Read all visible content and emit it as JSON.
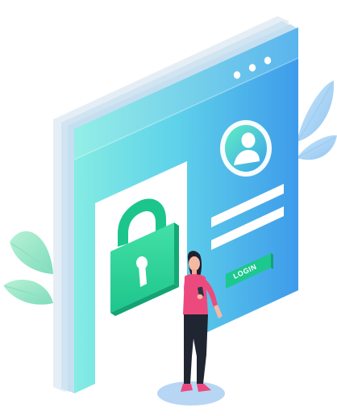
{
  "illustration": {
    "login_button_label": "LOGIN",
    "icons": [
      "padlock-icon",
      "user-avatar-icon",
      "window-menu-dots-icon",
      "leaf-icon"
    ],
    "colors": {
      "window_cyan": "#7ee6e4",
      "window_blue": "#3e9bea",
      "window_back": "#d9ecf6",
      "lock_green": "#27d49a",
      "lock_dark_green": "#16b57f",
      "leaf_mint": "#9be6c8",
      "leaf_blue": "#a8d2f3",
      "person_shirt": "#ec4a7f",
      "person_pants": "#1f2531",
      "shadow_blue": "#a9cdf3"
    }
  }
}
